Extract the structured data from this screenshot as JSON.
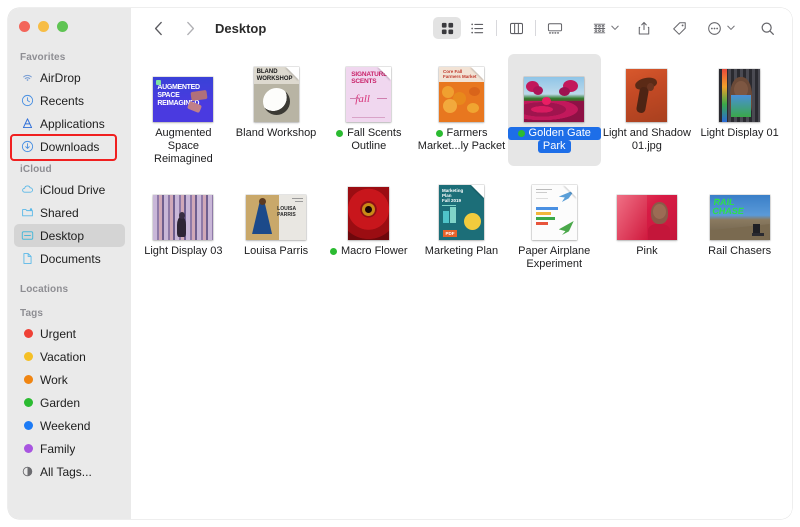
{
  "window": {
    "traffic_lights": [
      {
        "name": "close",
        "color": "#f3655a"
      },
      {
        "name": "minimize",
        "color": "#f7bd45"
      },
      {
        "name": "zoom",
        "color": "#5fc453"
      }
    ]
  },
  "sidebar": {
    "sections": [
      {
        "header": "Favorites",
        "items": [
          {
            "label": "AirDrop",
            "icon": "airdrop-icon",
            "selected": false
          },
          {
            "label": "Recents",
            "icon": "clock-icon",
            "selected": false
          },
          {
            "label": "Applications",
            "icon": "applications-icon",
            "selected": false
          },
          {
            "label": "Downloads",
            "icon": "downloads-icon",
            "selected": false,
            "annotated": true
          }
        ]
      },
      {
        "header": "iCloud",
        "items": [
          {
            "label": "iCloud Drive",
            "icon": "cloud-icon",
            "selected": false
          },
          {
            "label": "Shared",
            "icon": "shared-folder-icon",
            "selected": false
          },
          {
            "label": "Desktop",
            "icon": "desktop-icon",
            "selected": true
          },
          {
            "label": "Documents",
            "icon": "document-icon",
            "selected": false
          }
        ]
      },
      {
        "header": "Locations",
        "items": []
      },
      {
        "header": "Tags",
        "items": [
          {
            "label": "Urgent",
            "icon": "tag-dot",
            "color": "#ef4136",
            "selected": false
          },
          {
            "label": "Vacation",
            "icon": "tag-dot",
            "color": "#f5c026",
            "selected": false
          },
          {
            "label": "Work",
            "icon": "tag-dot",
            "color": "#f08512",
            "selected": false
          },
          {
            "label": "Garden",
            "icon": "tag-dot",
            "color": "#2bbb31",
            "selected": false
          },
          {
            "label": "Weekend",
            "icon": "tag-dot",
            "color": "#1d7bf5",
            "selected": false
          },
          {
            "label": "Family",
            "icon": "tag-dot",
            "color": "#a855e0",
            "selected": false
          },
          {
            "label": "All Tags...",
            "icon": "all-tags-icon",
            "selected": false
          }
        ]
      }
    ],
    "annotation_color": "#f01f1f"
  },
  "toolbar": {
    "back_label": "‹",
    "forward_label": "›",
    "title": "Desktop",
    "views": [
      {
        "name": "icon-view",
        "active": true
      },
      {
        "name": "list-view",
        "active": false
      },
      {
        "name": "column-view",
        "active": false
      },
      {
        "name": "gallery-view",
        "active": false
      }
    ],
    "actions": [
      {
        "name": "group-by-button"
      },
      {
        "name": "share-button"
      },
      {
        "name": "tag-button"
      },
      {
        "name": "more-actions-button"
      },
      {
        "name": "search-button"
      }
    ]
  },
  "files": [
    {
      "name": "Augmented Space Reimagined",
      "lines": [
        "Augmented",
        "Space Reimagined"
      ],
      "shape": "land",
      "tag": null,
      "selected": false
    },
    {
      "name": "Bland Workshop",
      "lines": [
        "Bland Workshop"
      ],
      "shape": "doc",
      "tag": null,
      "selected": false
    },
    {
      "name": "Fall Scents Outline",
      "lines": [
        "Fall Scents",
        "Outline"
      ],
      "shape": "doc",
      "tag": "#2bbb31",
      "selected": false
    },
    {
      "name": "Farmers Market...ly Packet",
      "lines": [
        "Farmers",
        "Market...ly Packet"
      ],
      "shape": "doc",
      "tag": "#2bbb31",
      "selected": false
    },
    {
      "name": "Golden Gate Park",
      "lines": [
        "Golden Gate",
        "Park"
      ],
      "shape": "land",
      "tag": "#2bbb31",
      "selected": true
    },
    {
      "name": "Light and Shadow 01.jpg",
      "lines": [
        "Light and Shadow",
        "01.jpg"
      ],
      "shape": "port",
      "tag": null,
      "selected": false
    },
    {
      "name": "Light Display 01",
      "lines": [
        "Light Display 01"
      ],
      "shape": "port",
      "tag": null,
      "selected": false
    },
    {
      "name": "Light Display 03",
      "lines": [
        "Light Display 03"
      ],
      "shape": "land",
      "tag": null,
      "selected": false
    },
    {
      "name": "Louisa Parris",
      "lines": [
        "Louisa Parris"
      ],
      "shape": "land",
      "tag": null,
      "selected": false
    },
    {
      "name": "Macro Flower",
      "lines": [
        "Macro Flower"
      ],
      "shape": "port",
      "tag": "#2bbb31",
      "selected": false
    },
    {
      "name": "Marketing Plan",
      "lines": [
        "Marketing Plan"
      ],
      "shape": "doc",
      "tag": null,
      "selected": false
    },
    {
      "name": "Paper Airplane Experiment",
      "lines": [
        "Paper Airplane",
        "Experiment"
      ],
      "shape": "doc",
      "tag": null,
      "selected": false
    },
    {
      "name": "Pink",
      "lines": [
        "Pink"
      ],
      "shape": "land",
      "tag": null,
      "selected": false
    },
    {
      "name": "Rail Chasers",
      "lines": [
        "Rail Chasers"
      ],
      "shape": "land",
      "tag": null,
      "selected": false
    }
  ]
}
